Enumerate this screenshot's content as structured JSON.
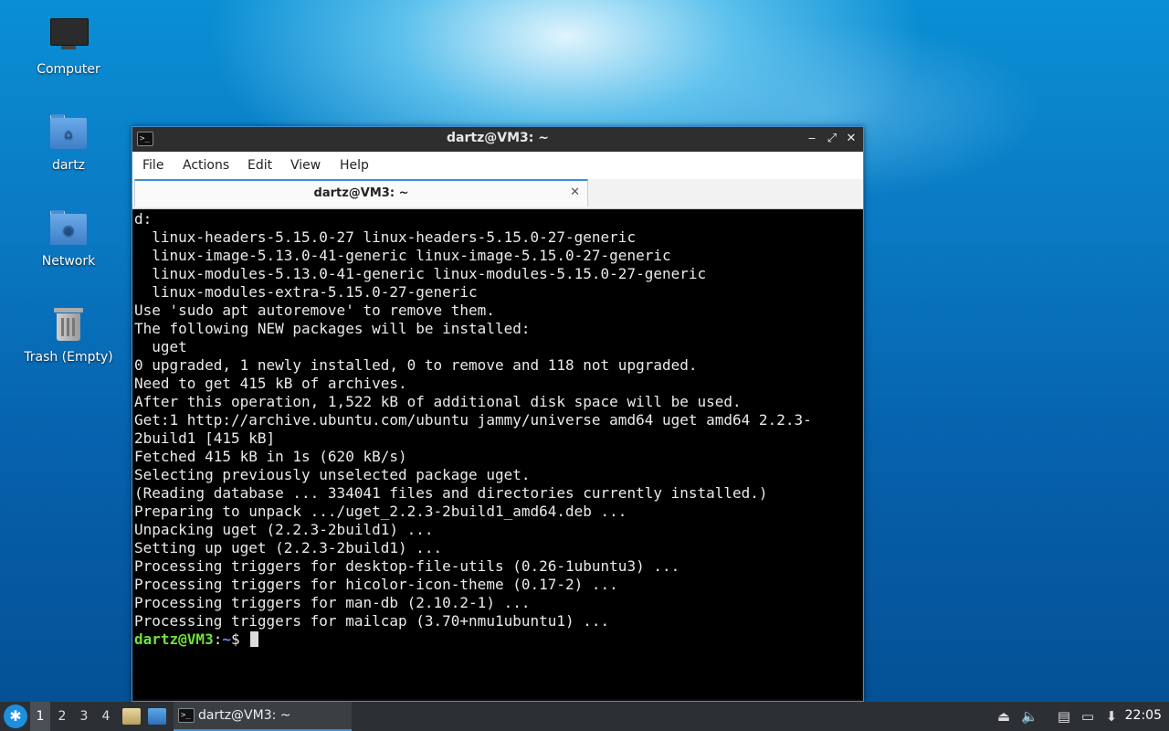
{
  "desktop": {
    "icons": [
      {
        "label": "Computer"
      },
      {
        "label": "dartz"
      },
      {
        "label": "Network"
      },
      {
        "label": "Trash (Empty)"
      }
    ]
  },
  "window": {
    "title": "dartz@VM3: ~",
    "controls": {
      "minimize": "‒",
      "maximize": "⤢",
      "close": "✕"
    }
  },
  "menubar": {
    "items": [
      "File",
      "Actions",
      "Edit",
      "View",
      "Help"
    ]
  },
  "tabs": [
    {
      "label": "dartz@VM3: ~",
      "close": "✕"
    }
  ],
  "terminal": {
    "lines": [
      "d:",
      "  linux-headers-5.15.0-27 linux-headers-5.15.0-27-generic",
      "  linux-image-5.13.0-41-generic linux-image-5.15.0-27-generic",
      "  linux-modules-5.13.0-41-generic linux-modules-5.15.0-27-generic",
      "  linux-modules-extra-5.15.0-27-generic",
      "Use 'sudo apt autoremove' to remove them.",
      "The following NEW packages will be installed:",
      "  uget",
      "0 upgraded, 1 newly installed, 0 to remove and 118 not upgraded.",
      "Need to get 415 kB of archives.",
      "After this operation, 1,522 kB of additional disk space will be used.",
      "Get:1 http://archive.ubuntu.com/ubuntu jammy/universe amd64 uget amd64 2.2.3-",
      "2build1 [415 kB]",
      "Fetched 415 kB in 1s (620 kB/s)",
      "Selecting previously unselected package uget.",
      "(Reading database ... 334041 files and directories currently installed.)",
      "Preparing to unpack .../uget_2.2.3-2build1_amd64.deb ...",
      "Unpacking uget (2.2.3-2build1) ...",
      "Setting up uget (2.2.3-2build1) ...",
      "Processing triggers for desktop-file-utils (0.26-1ubuntu3) ...",
      "Processing triggers for hicolor-icon-theme (0.17-2) ...",
      "Processing triggers for man-db (2.10.2-1) ...",
      "Processing triggers for mailcap (3.70+nmu1ubuntu1) ..."
    ],
    "prompt": {
      "user": "dartz@VM3",
      "sep": ":",
      "path": "~",
      "symbol": "$ "
    }
  },
  "taskbar": {
    "workspaces": [
      "1",
      "2",
      "3",
      "4"
    ],
    "active_workspace": "1",
    "task": {
      "label": "dartz@VM3: ~"
    },
    "clock": "22:05",
    "tray_icons": [
      "eject-icon",
      "volume-icon",
      "clipboard-icon",
      "network-icon",
      "update-icon"
    ]
  }
}
